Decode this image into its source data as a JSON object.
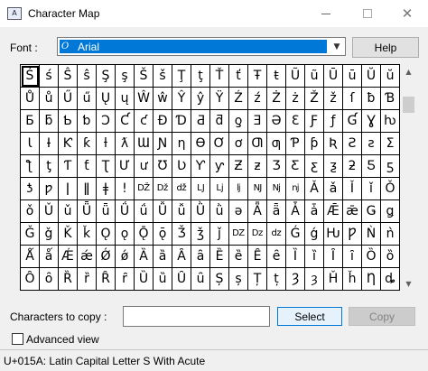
{
  "window": {
    "title": "Character Map",
    "icon": "charmap-app-icon",
    "controls": [
      "minimize",
      "maximize",
      "close"
    ]
  },
  "font": {
    "label": "Font :",
    "selected": "Arial",
    "icon": "opentype-font-icon"
  },
  "help_button": "Help",
  "grid": {
    "rows": [
      [
        "Ś",
        "ś",
        "Ŝ",
        "ŝ",
        "Ş",
        "ş",
        "Š",
        "š",
        "Ţ",
        "ţ",
        "Ť",
        "ť",
        "Ŧ",
        "ŧ",
        "Ũ",
        "ũ",
        "Ū",
        "ū",
        "Ŭ",
        "ŭ"
      ],
      [
        "Ů",
        "ů",
        "Ű",
        "ű",
        "Ų",
        "ų",
        "Ŵ",
        "ŵ",
        "Ŷ",
        "ŷ",
        "Ÿ",
        "Ź",
        "ź",
        "Ż",
        "ż",
        "Ž",
        "ž",
        "ſ",
        "ƀ",
        "Ɓ"
      ],
      [
        "Ƃ",
        "ƃ",
        "Ƅ",
        "ƅ",
        "Ɔ",
        "Ƈ",
        "ƈ",
        "Ɖ",
        "Ɗ",
        "Ƌ",
        "ƌ",
        "ƍ",
        "Ǝ",
        "Ə",
        "Ɛ",
        "Ƒ",
        "ƒ",
        "Ɠ",
        "Ɣ",
        "ƕ"
      ],
      [
        "Ɩ",
        "Ɨ",
        "Ƙ",
        "ƙ",
        "ƚ",
        "ƛ",
        "Ɯ",
        "Ɲ",
        "ƞ",
        "Ɵ",
        "Ơ",
        "ơ",
        "Ƣ",
        "ƣ",
        "Ƥ",
        "ƥ",
        "Ʀ",
        "Ƨ",
        "ƨ",
        "Ʃ"
      ],
      [
        "ƪ",
        "ƫ",
        "Ƭ",
        "ƭ",
        "Ʈ",
        "Ư",
        "ư",
        "Ʊ",
        "Ʋ",
        "Ƴ",
        "ƴ",
        "Ƶ",
        "ƶ",
        "Ʒ",
        "Ƹ",
        "ƹ",
        "ƺ",
        "ƻ",
        "Ƽ",
        "ƽ"
      ],
      [
        "ƾ",
        "ƿ",
        "ǀ",
        "ǁ",
        "ǂ",
        "ǃ",
        "Ǆ",
        "ǅ",
        "ǆ",
        "Ǉ",
        "ǈ",
        "ǉ",
        "Ǌ",
        "ǋ",
        "ǌ",
        "Ǎ",
        "ǎ",
        "Ǐ",
        "ǐ",
        "Ǒ"
      ],
      [
        "ǒ",
        "Ǔ",
        "ǔ",
        "Ǖ",
        "ǖ",
        "Ǘ",
        "ǘ",
        "Ǚ",
        "ǚ",
        "Ǜ",
        "ǜ",
        "ǝ",
        "Ǟ",
        "ǟ",
        "Ǡ",
        "ǡ",
        "Ǣ",
        "ǣ",
        "Ǥ",
        "ǥ"
      ],
      [
        "Ǧ",
        "ǧ",
        "Ǩ",
        "ǩ",
        "Ǫ",
        "ǫ",
        "Ǭ",
        "ǭ",
        "Ǯ",
        "ǯ",
        "ǰ",
        "Ǳ",
        "ǲ",
        "ǳ",
        "Ǵ",
        "ǵ",
        "Ƕ",
        "Ƿ",
        "Ǹ",
        "ǹ"
      ],
      [
        "Ǻ",
        "ǻ",
        "Ǽ",
        "ǽ",
        "Ǿ",
        "ǿ",
        "Ȁ",
        "ȁ",
        "Ȃ",
        "ȃ",
        "Ȅ",
        "ȅ",
        "Ȇ",
        "ȇ",
        "Ȉ",
        "ȉ",
        "Ȋ",
        "ȋ",
        "Ȍ",
        "ȍ"
      ],
      [
        "Ȏ",
        "ȏ",
        "Ȑ",
        "ȑ",
        "Ȓ",
        "ȓ",
        "Ȕ",
        "ȕ",
        "Ȗ",
        "ȗ",
        "Ș",
        "ș",
        "Ț",
        "ț",
        "Ȝ",
        "ȝ",
        "Ȟ",
        "ȟ",
        "Ƞ",
        "ȡ"
      ]
    ],
    "selected_char": "Ś"
  },
  "copy": {
    "label": "Characters to copy :",
    "value": "",
    "select_button": "Select",
    "copy_button": "Copy"
  },
  "advanced": {
    "label": "Advanced view",
    "checked": false
  },
  "status": {
    "text": "U+015A: Latin Capital Letter S With Acute"
  }
}
